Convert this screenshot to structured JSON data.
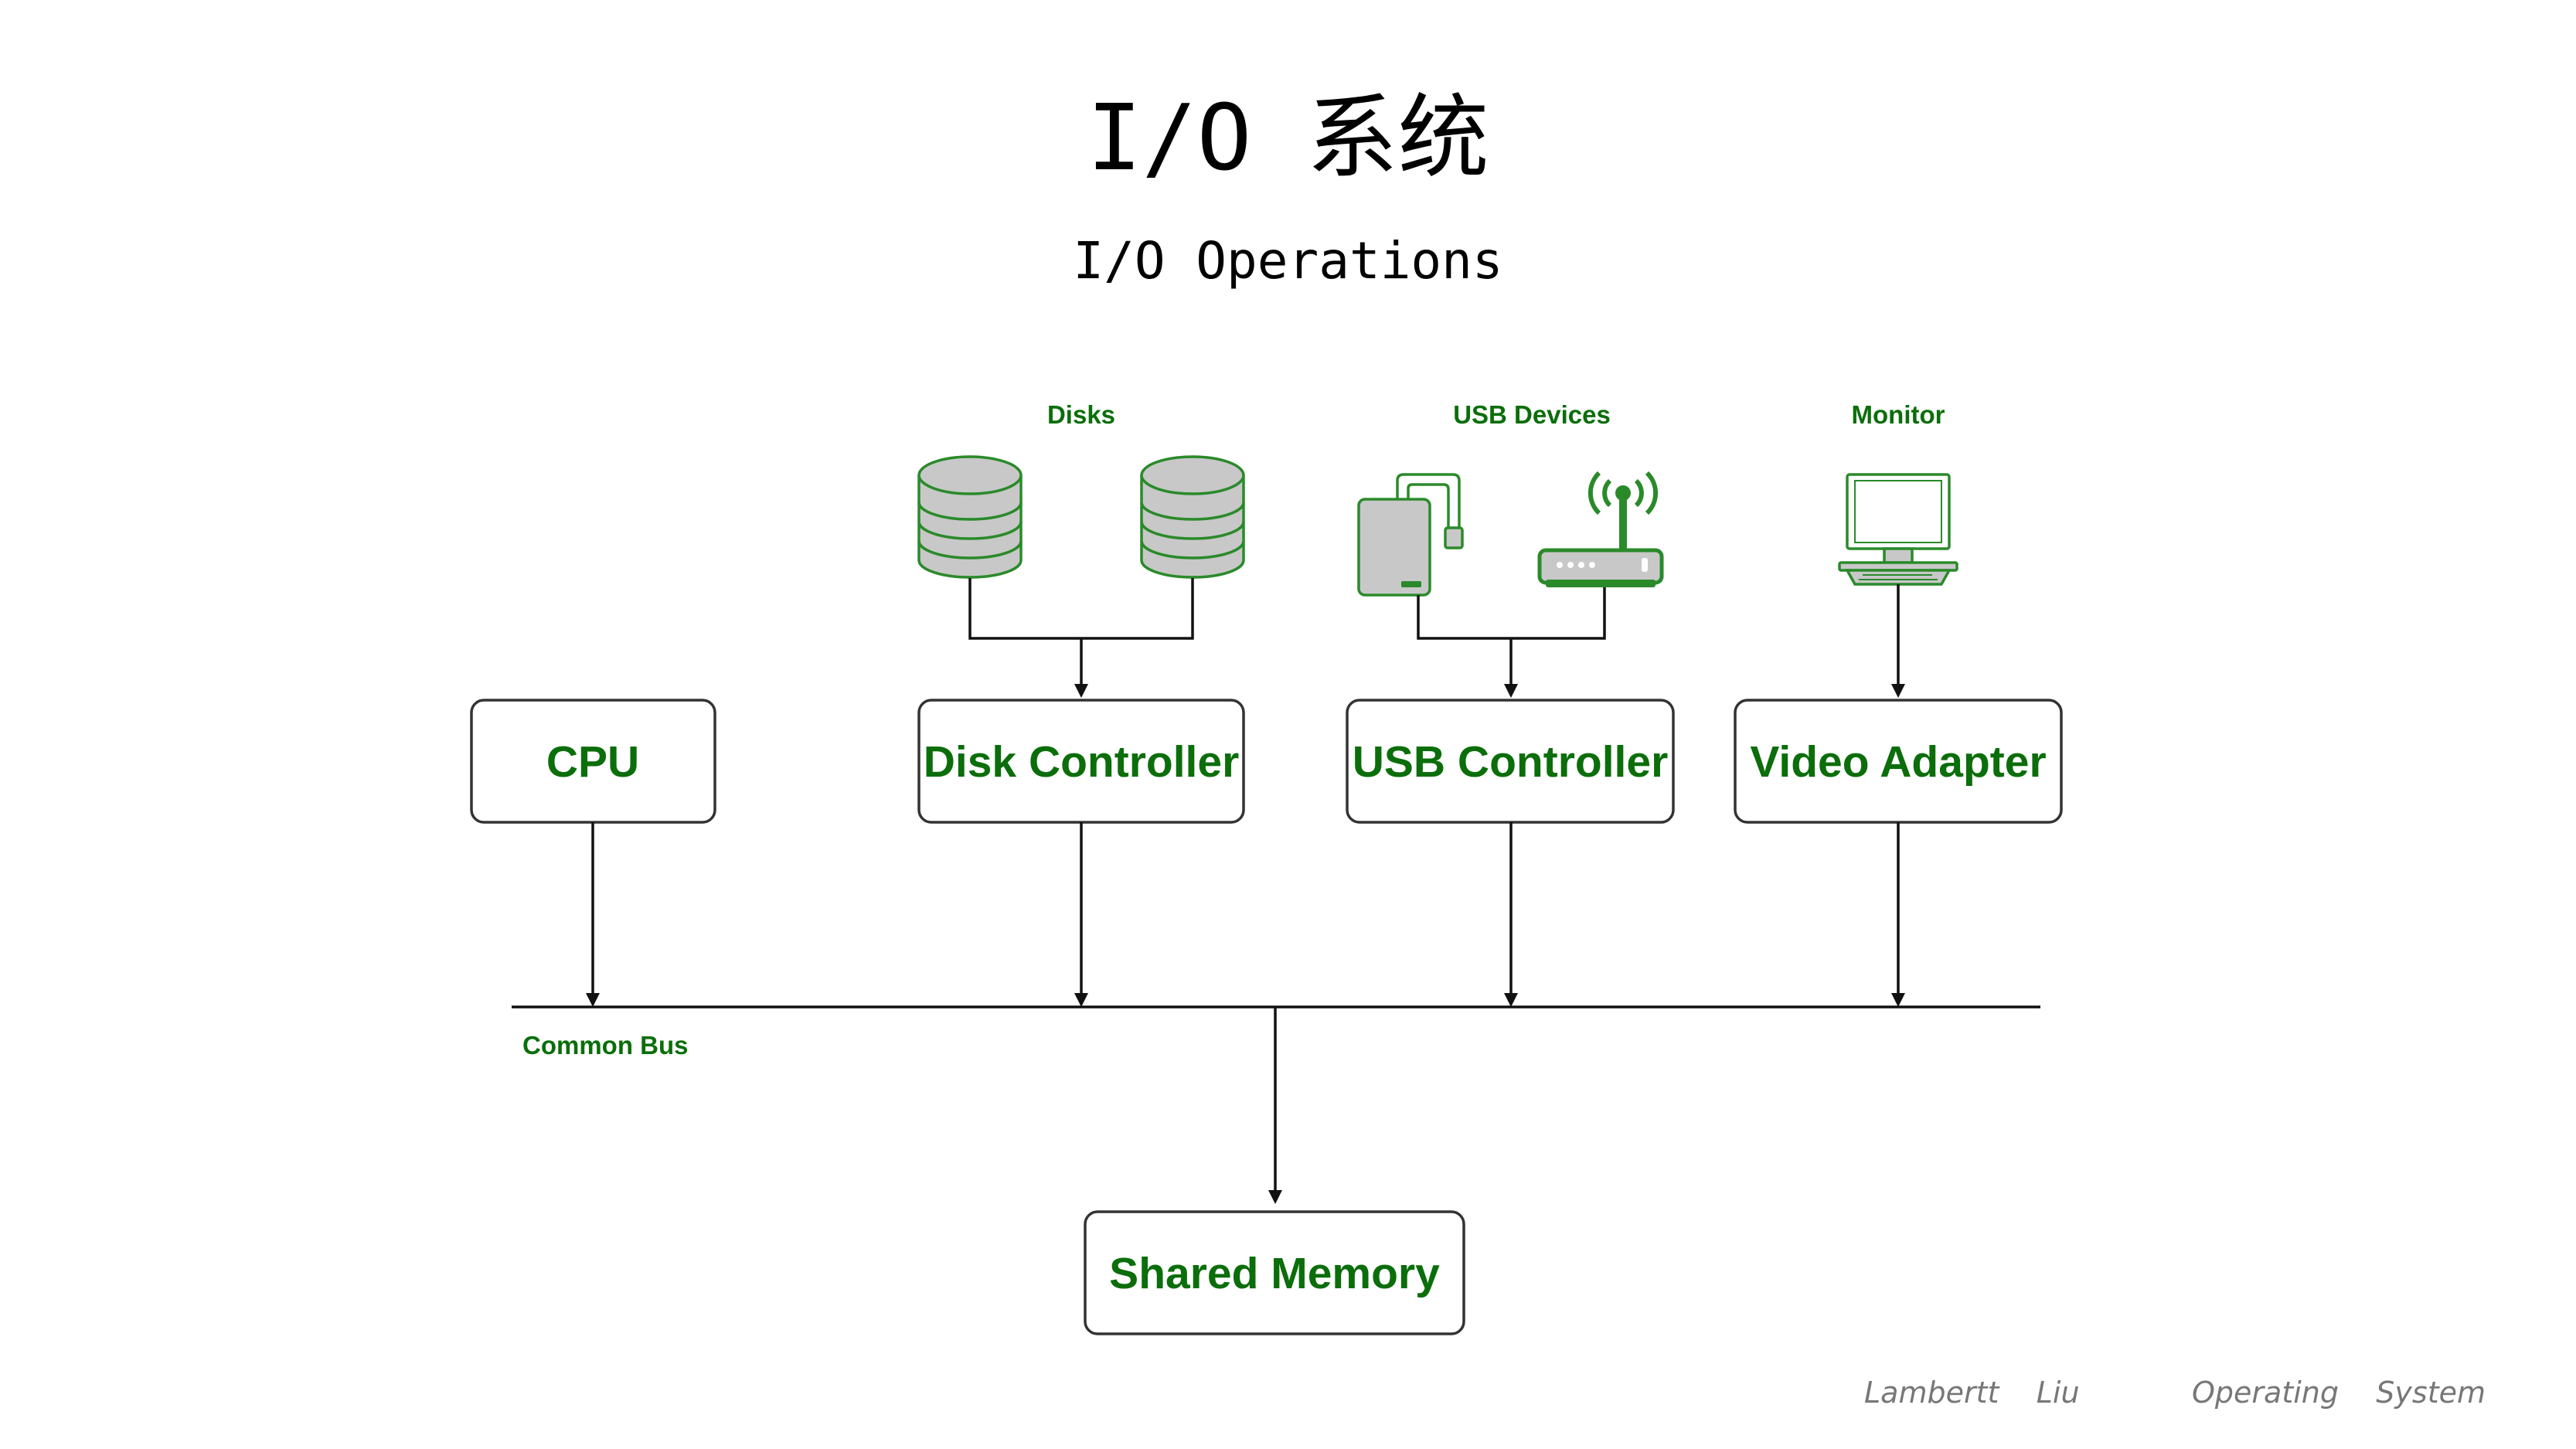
{
  "title": "I/O 系统",
  "subtitle": "I/O Operations",
  "diagram": {
    "boxes": {
      "cpu": "CPU",
      "disk_controller": "Disk Controller",
      "usb_controller": "USB Controller",
      "video_adapter": "Video Adapter",
      "shared_memory": "Shared Memory"
    },
    "labels": {
      "disks": "Disks",
      "usb_devices": "USB Devices",
      "monitor": "Monitor",
      "common_bus": "Common Bus"
    },
    "colors": {
      "label_green": "#0b6e0b",
      "device_green": "#2a8a2a",
      "device_gray": "#c8c8c8"
    },
    "icons": [
      "database-icon",
      "database-icon",
      "external-drive-icon",
      "wireless-router-icon",
      "monitor-icon"
    ]
  },
  "footer": {
    "author": "Lambertt    Liu",
    "course": "Operating    System"
  }
}
